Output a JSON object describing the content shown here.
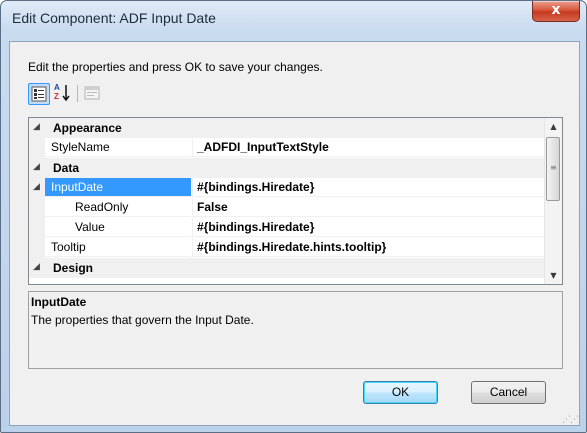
{
  "window": {
    "title": "Edit Component: ADF Input Date",
    "close_glyph": "x"
  },
  "instructions": "Edit the properties and press OK to save your changes.",
  "toolbar": {
    "buttons": [
      {
        "name": "categorized-icon",
        "state": "pressed"
      },
      {
        "name": "alphabetical-sort-icon",
        "glyph_top": "A",
        "glyph_bottom": "Z"
      },
      {
        "name": "property-pages-icon",
        "state": "disabled"
      }
    ]
  },
  "property_grid": {
    "categories": [
      {
        "label": "Appearance",
        "expander": "◢"
      },
      {
        "label": "Data",
        "expander": "◢"
      },
      {
        "label": "Design",
        "expander": "◢"
      }
    ],
    "rows": [
      {
        "name": "StyleName",
        "value": "_ADFDI_InputTextStyle"
      },
      {
        "name": "InputDate",
        "value": "#{bindings.Hiredate}",
        "selected": true,
        "expander": "◢"
      },
      {
        "name": "ReadOnly",
        "value": "False"
      },
      {
        "name": "Value",
        "value": "#{bindings.Hiredate}"
      },
      {
        "name": "Tooltip",
        "value": "#{bindings.Hiredate.hints.tooltip}"
      }
    ]
  },
  "help": {
    "title": "InputDate",
    "description": "The properties that govern the Input Date."
  },
  "buttons": {
    "ok": "OK",
    "cancel": "Cancel"
  },
  "colors": {
    "selection": "#3399ff",
    "close_button": "#c5391e",
    "frame": "#bcd1ea"
  }
}
